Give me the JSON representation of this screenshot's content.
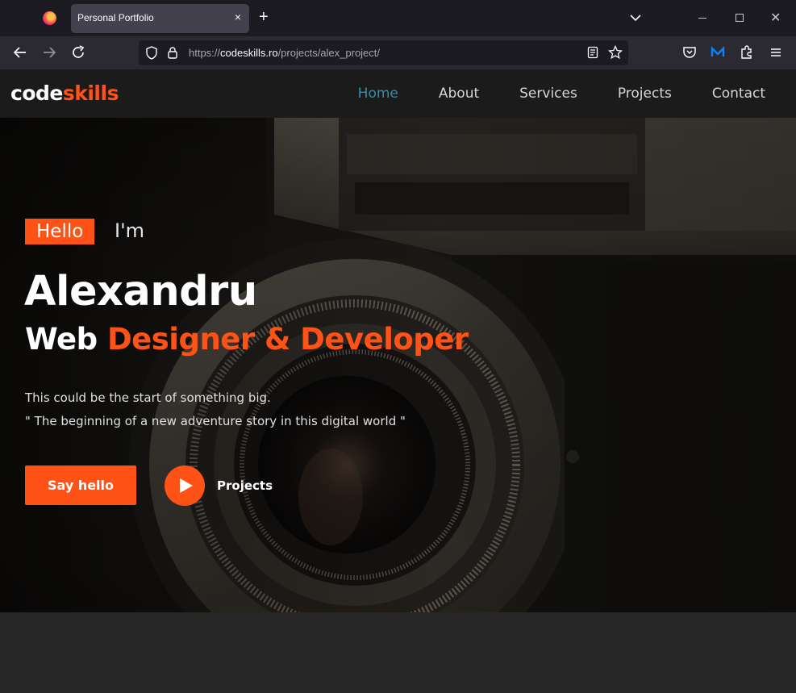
{
  "browser": {
    "tab_title": "Personal Portfolio",
    "tab_close": "×",
    "new_tab": "+",
    "url_prefix": "https://",
    "url_host": "codeskills.ro",
    "url_path": "/projects/alex_project/"
  },
  "site": {
    "logo_main": "code",
    "logo_accent": "skills",
    "nav": [
      {
        "label": "Home",
        "active": true
      },
      {
        "label": "About"
      },
      {
        "label": "Services"
      },
      {
        "label": "Projects"
      },
      {
        "label": "Contact"
      }
    ]
  },
  "hero": {
    "badge": "Hello",
    "im": "I'm",
    "name": "Alexandru",
    "role_prefix": "Web ",
    "role_accent": "Designer & Developer",
    "tagline": "This could be the start of something big.",
    "quote": "\" The beginning of a new adventure story in this digital world \"",
    "cta_primary": "Say hello",
    "cta_secondary": "Projects"
  },
  "colors": {
    "accent": "#ff5217",
    "active_nav": "#3d8aa6",
    "header_bg": "#1b1b1b"
  }
}
